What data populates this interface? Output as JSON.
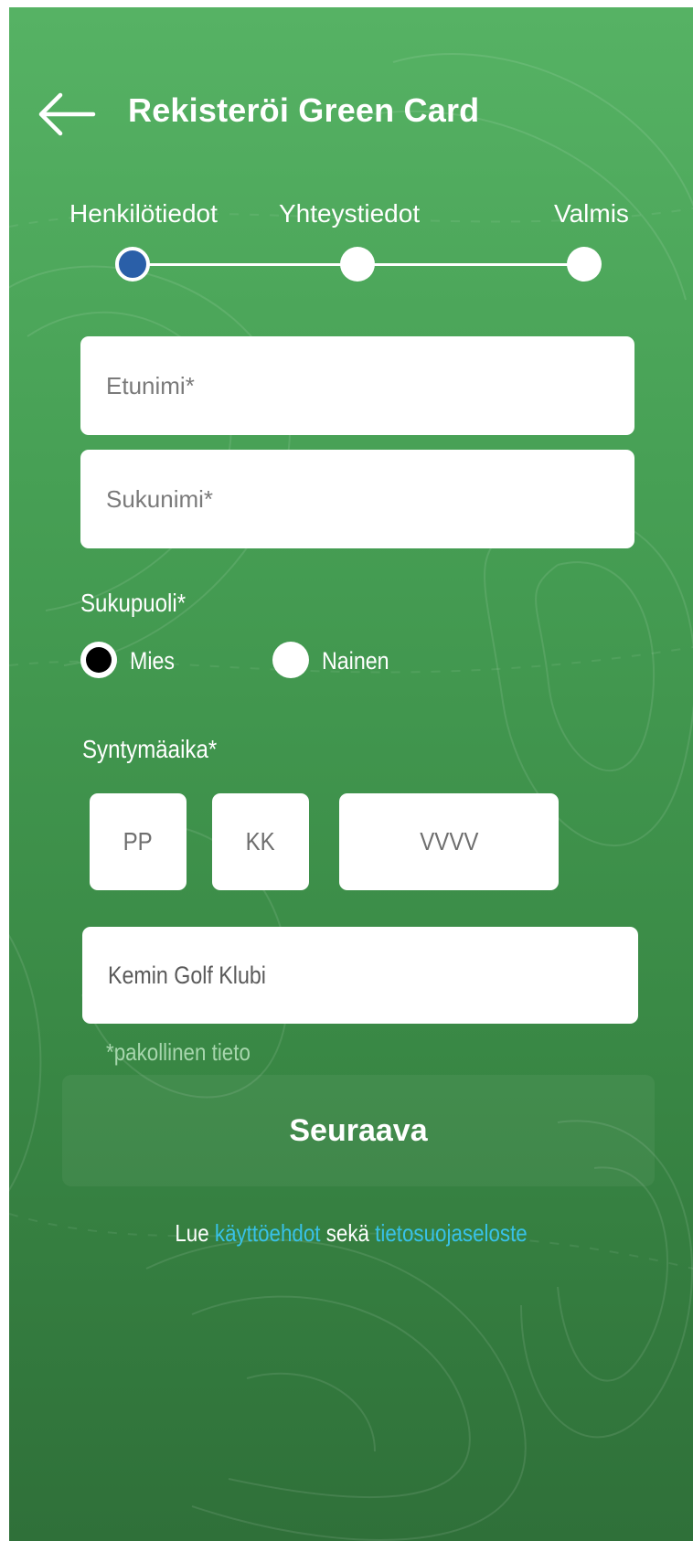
{
  "header": {
    "title": "Rekisteröi Green Card",
    "back_icon": "arrow-left-icon"
  },
  "stepper": {
    "steps": [
      {
        "label": "Henkilötiedot",
        "active": true
      },
      {
        "label": "Yhteystiedot",
        "active": false
      },
      {
        "label": "Valmis",
        "active": false
      }
    ]
  },
  "form": {
    "first_name": {
      "value": "",
      "placeholder": "Etunimi*"
    },
    "last_name": {
      "value": "",
      "placeholder": "Sukunimi*"
    },
    "gender": {
      "label": "Sukupuoli*",
      "options": [
        {
          "label": "Mies",
          "checked": true
        },
        {
          "label": "Nainen",
          "checked": false
        }
      ]
    },
    "birthdate": {
      "label": "Syntymäaika*",
      "day_placeholder": "PP",
      "month_placeholder": "KK",
      "year_placeholder": "VVVV"
    },
    "club": {
      "value": "Kemin Golf Klubi"
    },
    "required_note": "*pakollinen tieto"
  },
  "next_button": {
    "label": "Seuraava"
  },
  "terms": {
    "prefix": "Lue ",
    "link1": "käyttöehdot",
    "middle": " sekä ",
    "link2": "tietosuojaseloste"
  },
  "colors": {
    "background_top": "#56b264",
    "background_bottom": "#2f7039",
    "active_step": "#2a5fa8",
    "link": "#38c1e8"
  }
}
